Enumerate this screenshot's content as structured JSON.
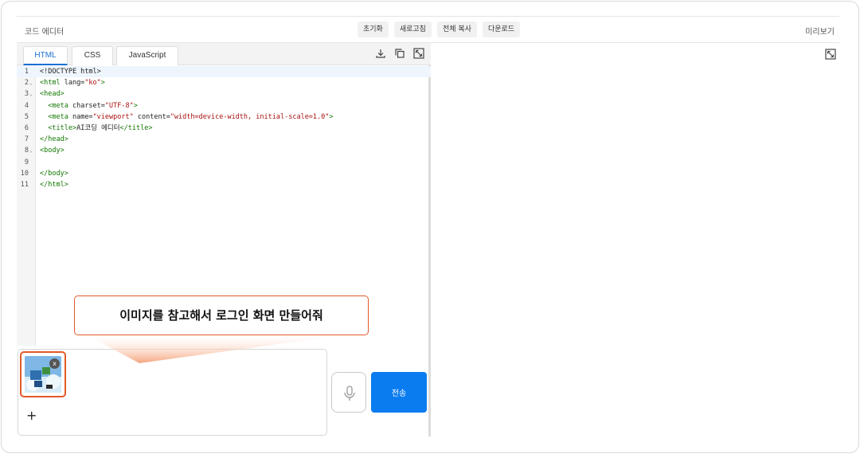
{
  "header": {
    "title": "코드 에디터",
    "preview_title": "미리보기",
    "buttons": [
      "초기화",
      "새로고침",
      "전체 복사",
      "다운로드"
    ]
  },
  "editor": {
    "tabs": [
      "HTML",
      "CSS",
      "JavaScript"
    ],
    "active_tab": "HTML",
    "tool_icons": [
      "download-icon",
      "copy-icon",
      "expand-icon"
    ],
    "lines": [
      {
        "n": "1",
        "fold": "",
        "parts": [
          [
            "txt",
            "<!DOCTYPE html>"
          ]
        ]
      },
      {
        "n": "2",
        "fold": "⌄",
        "parts": [
          [
            "tag",
            "<html"
          ],
          [
            "attr",
            " lang="
          ],
          [
            "str",
            "\"ko\""
          ],
          [
            "tag",
            ">"
          ]
        ]
      },
      {
        "n": "3",
        "fold": "⌄",
        "parts": [
          [
            "tag",
            "<head>"
          ]
        ]
      },
      {
        "n": "4",
        "fold": "",
        "parts": [
          [
            "txt",
            "  "
          ],
          [
            "tag",
            "<meta"
          ],
          [
            "attr",
            " charset="
          ],
          [
            "str",
            "\"UTF-8\""
          ],
          [
            "tag",
            ">"
          ]
        ]
      },
      {
        "n": "5",
        "fold": "",
        "parts": [
          [
            "txt",
            "  "
          ],
          [
            "tag",
            "<meta"
          ],
          [
            "attr",
            " name="
          ],
          [
            "str",
            "\"viewport\""
          ],
          [
            "attr",
            " content="
          ],
          [
            "str",
            "\"width=device-width, initial-scale=1.0\""
          ],
          [
            "tag",
            ">"
          ]
        ]
      },
      {
        "n": "6",
        "fold": "",
        "parts": [
          [
            "txt",
            "  "
          ],
          [
            "tag",
            "<title>"
          ],
          [
            "txt",
            "AI코딩 에디터"
          ],
          [
            "tag",
            "</title>"
          ]
        ]
      },
      {
        "n": "7",
        "fold": "",
        "parts": [
          [
            "tag",
            "</head>"
          ]
        ]
      },
      {
        "n": "8",
        "fold": "⌄",
        "parts": [
          [
            "tag",
            "<body>"
          ]
        ]
      },
      {
        "n": "9",
        "fold": "",
        "parts": []
      },
      {
        "n": "10",
        "fold": "",
        "parts": [
          [
            "tag",
            "</body>"
          ]
        ]
      },
      {
        "n": "11",
        "fold": "",
        "parts": [
          [
            "tag",
            "</html>"
          ]
        ]
      }
    ]
  },
  "prompt": {
    "bubble_text": "이미지를 참고해서 로그인 화면 만들어줘",
    "attachment_close": "x",
    "add_label": "+",
    "send_label": "전송"
  },
  "colors": {
    "accent": "#0b7cf0",
    "highlight": "#e05a2a",
    "tag": "#117700",
    "string": "#aa1111"
  }
}
